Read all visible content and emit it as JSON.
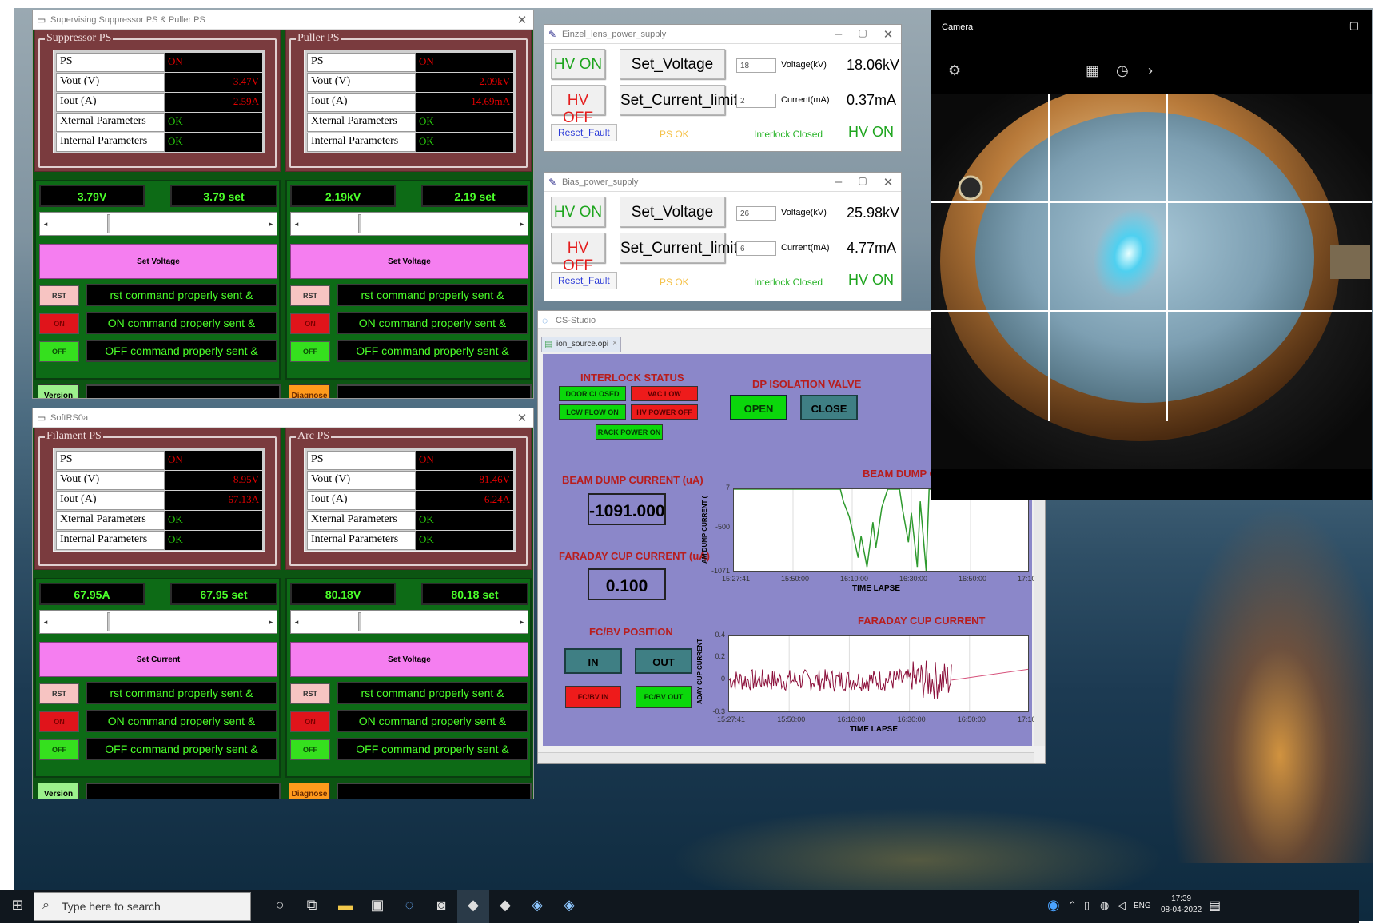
{
  "supp_window": {
    "title": "Supervising Suppressor PS & Puller PS",
    "panels": [
      {
        "group": "Suppressor PS",
        "rows": [
          {
            "label": "PS",
            "value": "ON"
          },
          {
            "label": "Vout (V)",
            "value": "3.47V"
          },
          {
            "label": "Iout (A)",
            "value": "2.59A"
          },
          {
            "label": "Xternal Parameters",
            "value": "OK"
          },
          {
            "label": "Internal Parameters",
            "value": "OK"
          }
        ],
        "readback": "3.79V",
        "setpoint": "3.79 set",
        "action": "Set Voltage",
        "rst": "RST",
        "on": "ON",
        "off": "OFF",
        "rst_msg": "rst command properly sent &",
        "on_msg": "ON command properly sent &",
        "off_msg": "OFF command properly sent &",
        "footer_btn": "Version"
      },
      {
        "group": "Puller PS",
        "rows": [
          {
            "label": "PS",
            "value": "ON"
          },
          {
            "label": "Vout (V)",
            "value": "2.09kV"
          },
          {
            "label": "Iout (A)",
            "value": "14.69mA"
          },
          {
            "label": "Xternal Parameters",
            "value": "OK"
          },
          {
            "label": "Internal Parameters",
            "value": "OK"
          }
        ],
        "readback": "2.19kV",
        "setpoint": "2.19 set",
        "action": "Set Voltage",
        "rst": "RST",
        "on": "ON",
        "off": "OFF",
        "rst_msg": "rst command properly sent &",
        "on_msg": "ON command properly sent &",
        "off_msg": "OFF command properly sent &",
        "footer_btn": "Diagnose"
      }
    ]
  },
  "soft_window": {
    "title": "SoftRS0a",
    "panels": [
      {
        "group": "Filament PS",
        "rows": [
          {
            "label": "PS",
            "value": "ON"
          },
          {
            "label": "Vout (V)",
            "value": "8.95V"
          },
          {
            "label": "Iout (A)",
            "value": "67.13A"
          },
          {
            "label": "Xternal Parameters",
            "value": "OK"
          },
          {
            "label": "Internal Parameters",
            "value": "OK"
          }
        ],
        "readback": "67.95A",
        "setpoint": "67.95 set",
        "action": "Set Current",
        "rst": "RST",
        "on": "ON",
        "off": "OFF",
        "rst_msg": "rst command properly sent &",
        "on_msg": "ON command properly sent &",
        "off_msg": "OFF command properly sent &",
        "footer_btn": "Version"
      },
      {
        "group": "Arc PS",
        "rows": [
          {
            "label": "PS",
            "value": "ON"
          },
          {
            "label": "Vout (V)",
            "value": "81.46V"
          },
          {
            "label": "Iout (A)",
            "value": "6.24A"
          },
          {
            "label": "Xternal Parameters",
            "value": "OK"
          },
          {
            "label": "Internal Parameters",
            "value": "OK"
          }
        ],
        "readback": "80.18V",
        "setpoint": "80.18 set",
        "action": "Set Voltage",
        "rst": "RST",
        "on": "ON",
        "off": "OFF",
        "rst_msg": "rst command properly sent &",
        "on_msg": "ON command properly sent &",
        "off_msg": "OFF command properly sent &",
        "footer_btn": "Diagnose"
      }
    ]
  },
  "einzel": {
    "title": "Einzel_lens_power_supply",
    "hv_on": "HV ON",
    "hv_off": "HV OFF",
    "set_voltage": "Set_Voltage",
    "set_current": "Set_Current_limit",
    "voltage_input": "18",
    "current_input": "2",
    "voltage_unit": "Voltage(kV)",
    "current_unit": "Current(mA)",
    "voltage_read": "18.06kV",
    "current_read": "0.37mA",
    "reset": "Reset_Fault",
    "ps_ok": "PS OK",
    "interlock": "Interlock Closed",
    "hv_state": "HV  ON"
  },
  "bias": {
    "title": "Bias_power_supply",
    "hv_on": "HV ON",
    "hv_off": "HV OFF",
    "set_voltage": "Set_Voltage",
    "set_current": "Set_Current_limit",
    "voltage_input": "26",
    "current_input": "6",
    "voltage_unit": "Voltage(kV)",
    "current_unit": "Current(mA)",
    "voltage_read": "25.98kV",
    "current_read": "4.77mA",
    "reset": "Reset_Fault",
    "ps_ok": "PS OK",
    "interlock": "Interlock Closed",
    "hv_state": "HV  ON"
  },
  "cs_studio": {
    "title": "CS-Studio",
    "tab": "ion_source.opi",
    "interlock_title": "INTERLOCK  STATUS",
    "interlock_leds": [
      {
        "label": "DOOR CLOSED",
        "state": "ok"
      },
      {
        "label": "VAC LOW",
        "state": "fault"
      },
      {
        "label": "LCW FLOW ON",
        "state": "ok"
      },
      {
        "label": "HV POWER OFF",
        "state": "fault"
      },
      {
        "label": "RACK POWER ON",
        "state": "ok"
      }
    ],
    "dp_valve_title": "DP ISOLATION VALVE",
    "open": "OPEN",
    "close": "CLOSE",
    "beam_dump_label": "BEAM DUMP CURRENT (uA)",
    "beam_dump_value": "-1091.000",
    "faraday_label": "FARADAY CUP CURRENT (uA)",
    "faraday_value": "0.100",
    "fcbv_title": "FC/BV POSITION",
    "in": "IN",
    "out": "OUT",
    "fcbv_in": "FC/BV IN",
    "fcbv_out": "FC/BV OUT",
    "colors": {
      "panel": "#8b87c9",
      "led_ok": "#0bd70b",
      "led_fault": "#ee1b1b",
      "beam_trace": "#2e9a2e",
      "faraday_trace": "#8b0f3a"
    }
  },
  "chart_data": [
    {
      "type": "line",
      "title": "BEAM DUMP CURRENT",
      "ylabel": "AM DUMP CURRENT (",
      "xlabel": "TIME LAPSE",
      "x_ticks": [
        "15:27:41",
        "15:50:00",
        "16:10:00",
        "16:30:00",
        "16:50:00",
        "17:10"
      ],
      "y_ticks": [
        "7",
        "-500",
        "-1071"
      ],
      "ylim": [
        -1071,
        7
      ],
      "series": [
        {
          "x": [
            0.0,
            0.36,
            0.37,
            0.39,
            0.4,
            0.42,
            0.43,
            0.45,
            0.47,
            0.48,
            0.5,
            0.52,
            0.54,
            0.56,
            0.57,
            0.59,
            0.6,
            0.62,
            0.63,
            0.65,
            0.66,
            1.0
          ],
          "y": [
            7,
            7,
            -150,
            -350,
            -520,
            -880,
            -600,
            -1000,
            -420,
            -750,
            -230,
            7,
            7,
            7,
            -250,
            -680,
            -300,
            -1000,
            -150,
            -1050,
            7,
            7
          ]
        }
      ]
    },
    {
      "type": "line",
      "title": "FARADAY CUP CURRENT",
      "ylabel": "ADAY CUP CURRENT",
      "xlabel": "TIME LAPSE",
      "x_ticks": [
        "15:27:41",
        "15:50:00",
        "16:10:00",
        "16:30:00",
        "16:50:00",
        "17:10"
      ],
      "y_ticks": [
        "0.4",
        "0.2",
        "0",
        "-0.3"
      ],
      "ylim": [
        -0.3,
        0.4
      ],
      "series": [
        {
          "description_band": "noise",
          "band_start": 0.0,
          "band_end": 0.74,
          "center": 0.0,
          "amplitude": 0.1,
          "burst_start": 0.61,
          "burst_amplitude": 0.18,
          "ramp_end": 0.1
        }
      ]
    }
  ],
  "camera": {
    "title": "Camera"
  },
  "taskbar": {
    "search_placeholder": "Type here to search",
    "lang": "ENG",
    "time": "17:39",
    "date": "08-04-2022"
  }
}
